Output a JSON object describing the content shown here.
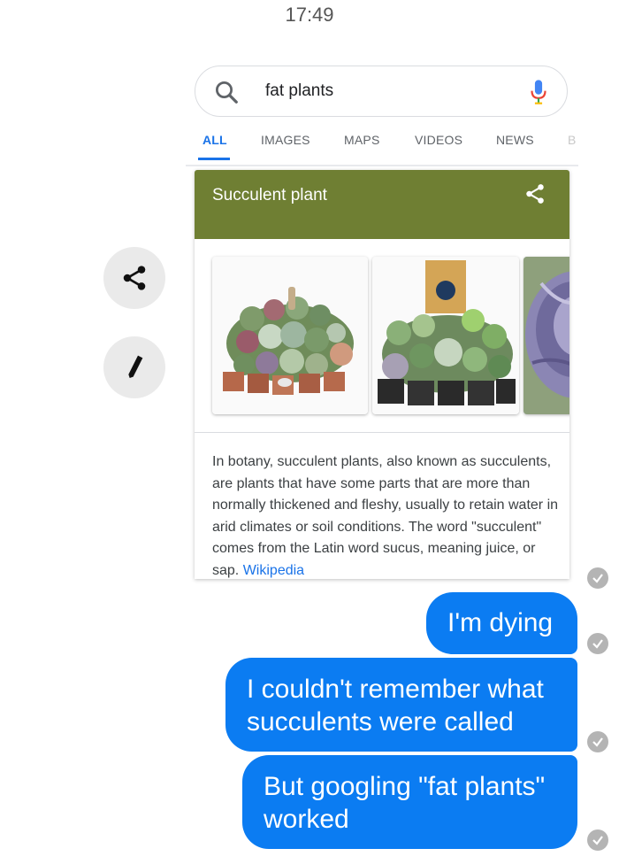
{
  "status_bar": {
    "time": "17:49"
  },
  "search": {
    "query": "fat plants"
  },
  "tabs": [
    {
      "label": "ALL",
      "active": true
    },
    {
      "label": "IMAGES"
    },
    {
      "label": "MAPS"
    },
    {
      "label": "VIDEOS"
    },
    {
      "label": "NEWS"
    },
    {
      "label": "B"
    }
  ],
  "knowledge_card": {
    "title": "Succulent plant",
    "header_color": "#6f7f33",
    "description": "In botany, succulent plants, also known as succulents, are plants that have some parts that are more than normally thickened and fleshy, usually to retain water in arid climates or soil conditions. The word \"succulent\" comes from the Latin word sucus, meaning juice, or sap.",
    "source_link": "Wikipedia"
  },
  "messages": [
    {
      "text": "I'm dying"
    },
    {
      "text": "I couldn't remember what succulents were called"
    },
    {
      "text": "But googling \"fat plants\" worked"
    }
  ],
  "colors": {
    "bubble": "#0b7cf2",
    "accent": "#1a73e8",
    "check": "#b4b4b4"
  }
}
